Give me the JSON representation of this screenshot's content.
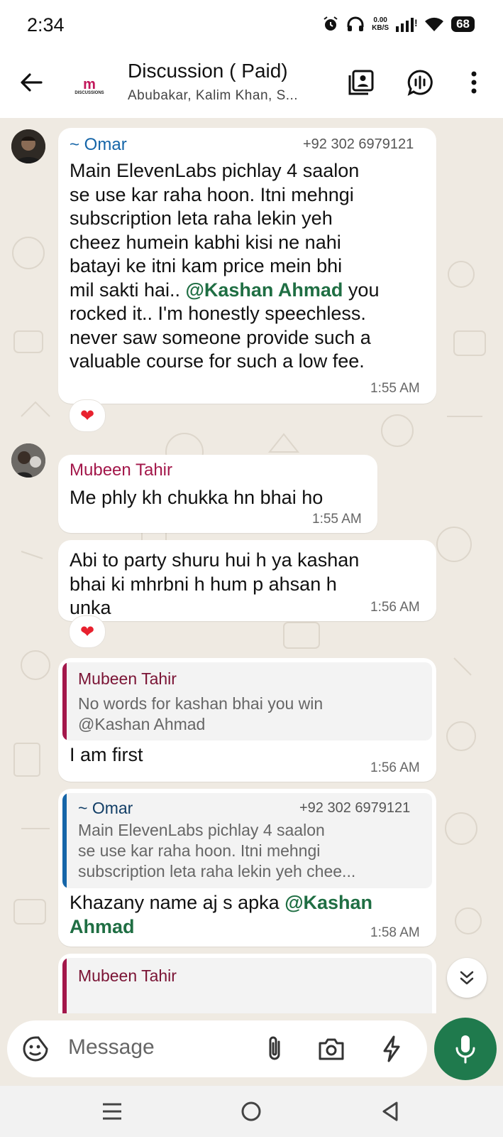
{
  "status_bar": {
    "time": "2:34",
    "net_speed_value": "0.00",
    "net_speed_unit": "KB/S",
    "battery": "68"
  },
  "header": {
    "title": "Discussion ( Paid)",
    "subtitle": "Abubakar, Kalim Khan, S...",
    "logo_text": "DISCUSSIONS"
  },
  "messages": [
    {
      "sender": "~ Omar",
      "phone": "+92 302 6979121",
      "lines": [
        "Main ElevenLabs pichlay 4 saalon",
        "se use kar raha hoon. Itni mehngi",
        "subscription leta raha lekin yeh",
        "cheez humein kabhi kisi ne nahi",
        "batayi ke itni kam price mein bhi"
      ],
      "line6_pre": "mil sakti hai.. ",
      "mention": "@Kashan Ahmad",
      "line6_post": "  you",
      "lines_after": [
        "rocked it.. I'm honestly speechless.",
        "never saw someone provide such a",
        "valuable course for such a low fee."
      ],
      "time": "1:55 AM",
      "reaction": "❤"
    },
    {
      "sender": "Mubeen Tahir",
      "text": "Me phly kh chukka hn bhai ho",
      "time": "1:55 AM"
    },
    {
      "lines": [
        "Abi to party  shuru hui h ya  kashan",
        "bhai ki mhrbni h  hum p ahsan h",
        "unka"
      ],
      "time": "1:56 AM",
      "reaction": "❤"
    },
    {
      "quote": {
        "name": "Mubeen Tahir",
        "lines": [
          "No words for kashan bhai you win",
          "@Kashan Ahmad"
        ]
      },
      "text": "I am first",
      "time": "1:56 AM"
    },
    {
      "quote": {
        "name": "~ Omar",
        "phone": "+92 302 6979121",
        "lines": [
          "Main ElevenLabs pichlay 4 saalon",
          "se use kar raha hoon. Itni mehngi",
          "subscription leta raha lekin yeh chee..."
        ]
      },
      "text_pre": "Khazany name aj s apka  ",
      "mention1": "@Kashan",
      "mention2": "Ahmad",
      "time": "1:58 AM"
    },
    {
      "quote": {
        "name": "Mubeen Tahir"
      }
    }
  ],
  "composer": {
    "placeholder": "Message"
  },
  "colors": {
    "accent_green": "#1f7a4d",
    "mention_green": "#1f6e43",
    "omar_blue": "#1565a8",
    "mubeen_maroon": "#a3174a",
    "chat_bg": "#efeae2"
  },
  "icons": [
    "back-arrow-icon",
    "contact-card-icon",
    "voice-chat-icon",
    "more-vert-icon",
    "sticker-icon",
    "attach-icon",
    "camera-icon",
    "lightning-icon",
    "mic-icon",
    "chevron-double-down-icon"
  ]
}
